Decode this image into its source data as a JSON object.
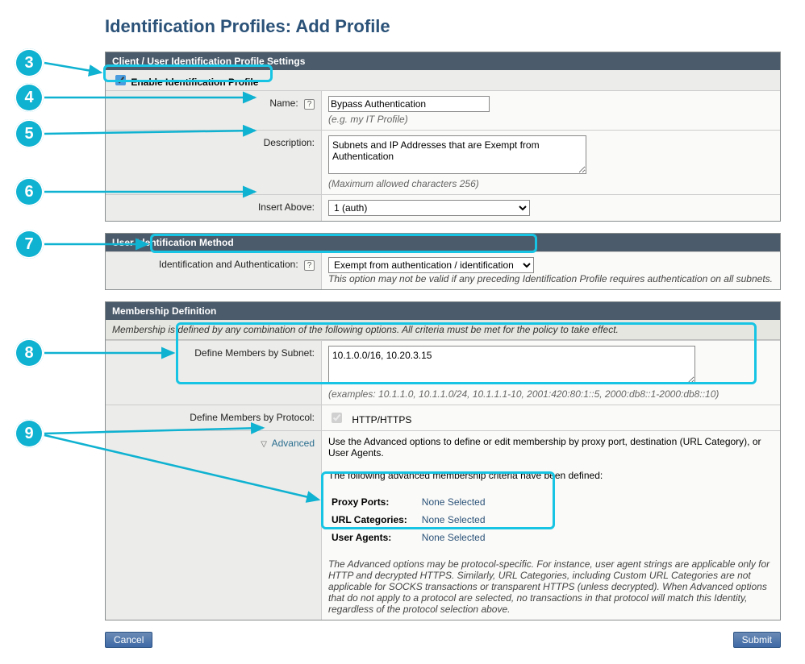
{
  "page_title": "Identification Profiles: Add Profile",
  "callouts": [
    "3",
    "4",
    "5",
    "6",
    "7",
    "8",
    "9"
  ],
  "settings": {
    "header": "Client / User Identification Profile Settings",
    "enable_label": "Enable Identification Profile",
    "name_label": "Name:",
    "name_value": "Bypass Authentication",
    "name_hint": "(e.g. my IT Profile)",
    "desc_label": "Description:",
    "desc_value": "Subnets and IP Addresses that are Exempt from Authentication",
    "desc_hint": "(Maximum allowed characters 256)",
    "insert_label": "Insert Above:",
    "insert_options": [
      "1 (auth)"
    ]
  },
  "method": {
    "header": "User Identification Method",
    "id_label": "Identification and Authentication:",
    "id_value": "Exempt from authentication / identification",
    "id_hint": "This option may not be valid if any preceding Identification Profile requires authentication on all subnets."
  },
  "membership": {
    "header": "Membership Definition",
    "info": "Membership is defined by any combination of the following options. All criteria must be met for the policy to take effect.",
    "subnet_label": "Define Members by Subnet:",
    "subnet_value": "10.1.0.0/16, 10.20.3.15",
    "subnet_hint": "(examples: 10.1.1.0, 10.1.1.0/24, 10.1.1.1-10, 2001:420:80:1::5, 2000:db8::1-2000:db8::10)",
    "protocol_label": "Define Members by Protocol:",
    "protocol_value": "HTTP/HTTPS",
    "advanced_label": "Advanced",
    "advanced_text1": "Use the Advanced options to define or edit membership by proxy port, destination (URL Category), or User Agents.",
    "advanced_text2": "The following advanced membership criteria have been defined:",
    "adv_rows": {
      "proxy_label": "Proxy Ports:",
      "proxy_val": "None Selected",
      "url_label": "URL Categories:",
      "url_val": "None Selected",
      "ua_label": "User Agents:",
      "ua_val": "None Selected"
    },
    "advanced_footer": "The Advanced options may be protocol-specific. For instance, user agent strings are applicable only for HTTP and decrypted HTTPS. Similarly, URL Categories, including Custom URL Categories are not applicable for SOCKS transactions or transparent HTTPS (unless decrypted). When Advanced options that do not apply to a protocol are selected, no transactions in that protocol will match this Identity, regardless of the protocol selection above."
  },
  "buttons": {
    "cancel": "Cancel",
    "submit": "Submit"
  }
}
